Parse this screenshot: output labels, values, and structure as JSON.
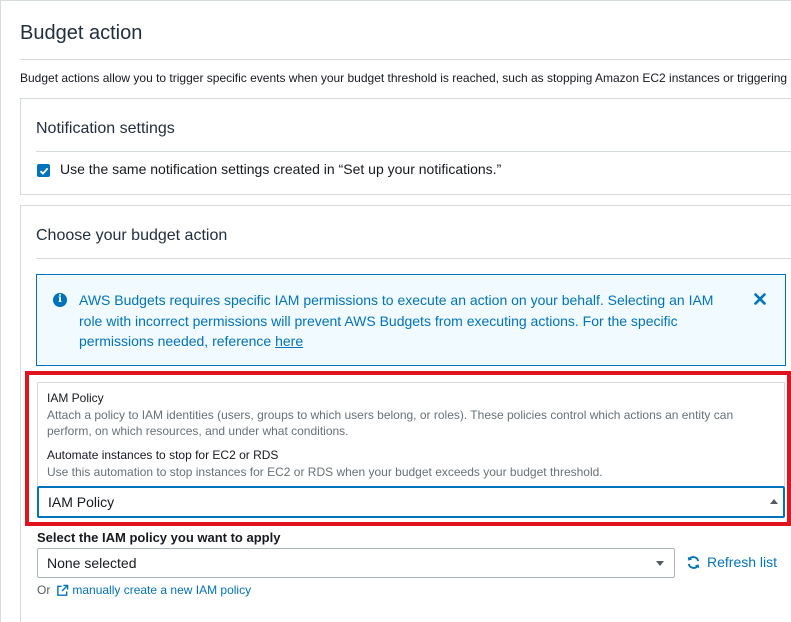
{
  "page": {
    "title": "Budget action",
    "description": "Budget actions allow you to trigger specific events when your budget threshold is reached, such as stopping Amazon EC2 instances or triggering"
  },
  "notification_settings": {
    "title": "Notification settings",
    "checkbox_label": "Use the same notification settings created in “Set up your notifications.”",
    "checked": true
  },
  "budget_action": {
    "title": "Choose your budget action",
    "info": {
      "text": "AWS Budgets requires specific IAM permissions to execute an action on your behalf. Selecting an IAM role with incorrect permissions will prevent AWS Budgets from executing actions. For the specific permissions needed, reference ",
      "link": "here",
      "icon": "info-icon",
      "close_icon": "close-icon"
    },
    "action_options": [
      {
        "title": "IAM Policy",
        "description": "Attach a policy to IAM identities (users, groups to which users belong, or roles). These policies control which actions an entity can perform, on which resources, and under what conditions."
      },
      {
        "title": "Automate instances to stop for EC2 or RDS",
        "description": "Use this automation to stop instances for EC2 or RDS when your budget exceeds your budget threshold."
      }
    ],
    "action_selected": "IAM Policy",
    "policy_label": "Select the IAM policy you want to apply",
    "policy_selected": "None selected",
    "refresh_label": "Refresh list",
    "or_text": "Or",
    "create_link": "manually create a new IAM policy"
  },
  "colors": {
    "accent": "#0073bb",
    "highlight": "#e0141e",
    "info_bg": "#f1faff"
  }
}
